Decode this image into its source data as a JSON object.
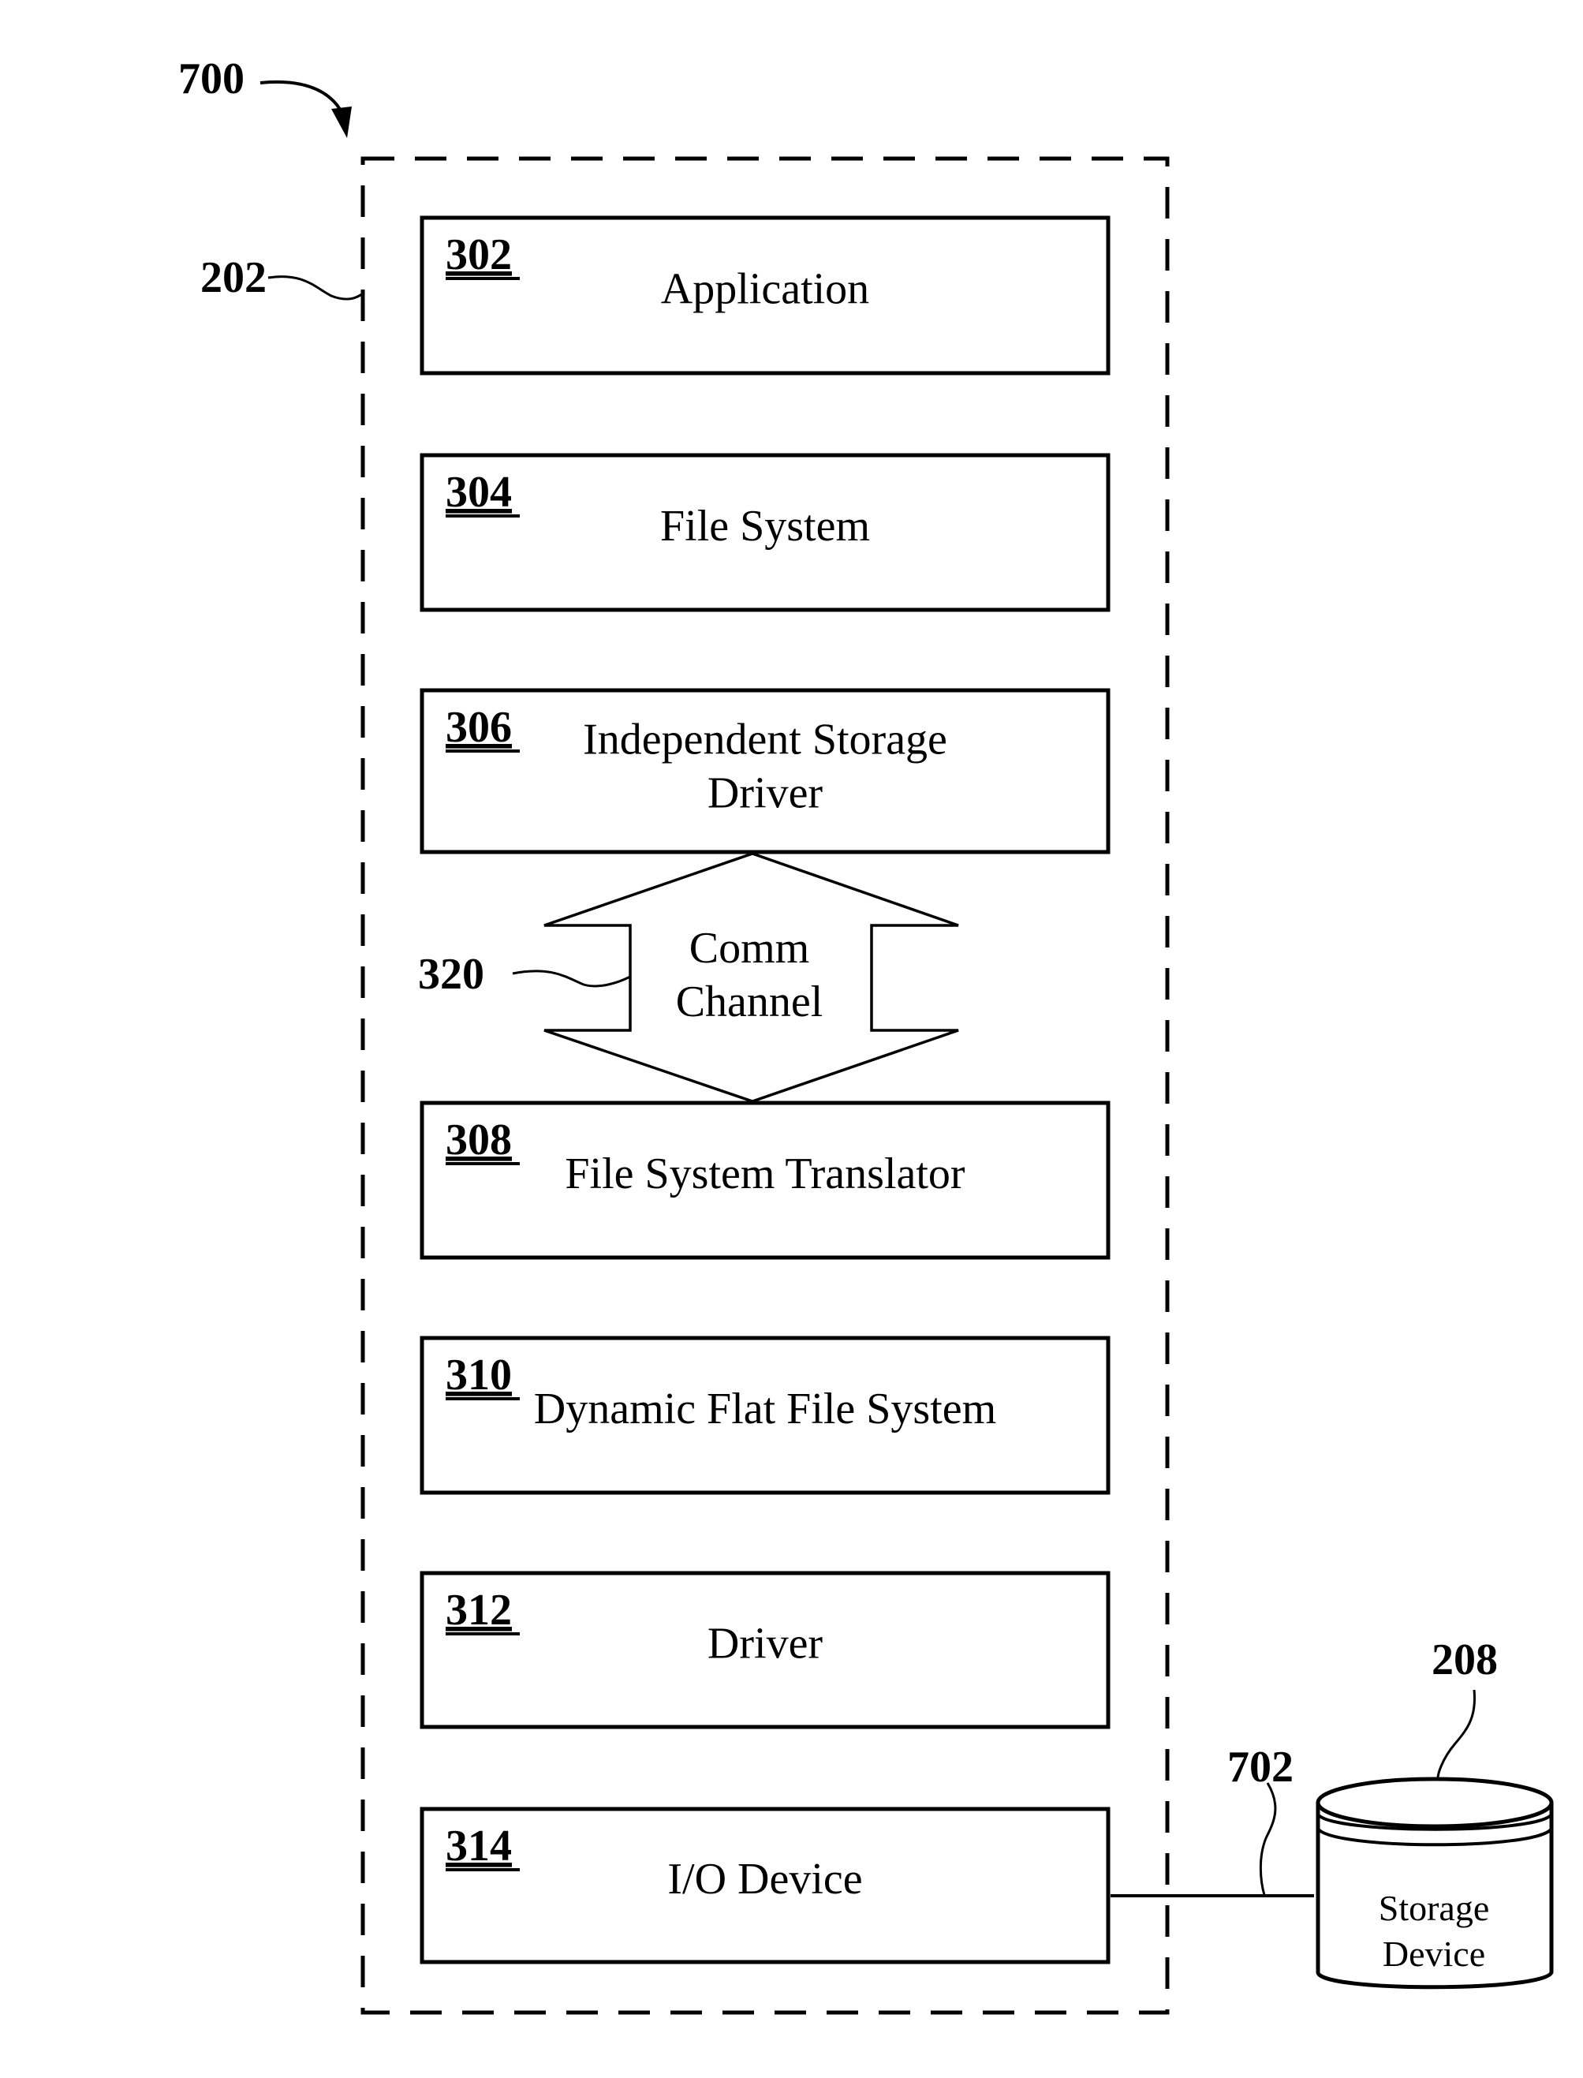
{
  "figure": {
    "ref": "700",
    "container_ref": "202"
  },
  "layers": [
    {
      "ref": "302",
      "lines": [
        "Application"
      ]
    },
    {
      "ref": "304",
      "lines": [
        "File System"
      ]
    },
    {
      "ref": "306",
      "lines": [
        "Independent Storage",
        "Driver"
      ]
    },
    {
      "ref": "308",
      "lines": [
        "File System Translator"
      ]
    },
    {
      "ref": "310",
      "lines": [
        "Dynamic Flat File System"
      ]
    },
    {
      "ref": "312",
      "lines": [
        "Driver"
      ]
    },
    {
      "ref": "314",
      "lines": [
        "I/O Device"
      ]
    }
  ],
  "comm_channel": {
    "ref": "320",
    "lines": [
      "Comm",
      "Channel"
    ]
  },
  "connection": {
    "ref": "702"
  },
  "storage": {
    "ref": "208",
    "lines": [
      "Storage",
      "Device"
    ]
  },
  "colors": {
    "stroke": "#000000",
    "background": "#ffffff"
  }
}
